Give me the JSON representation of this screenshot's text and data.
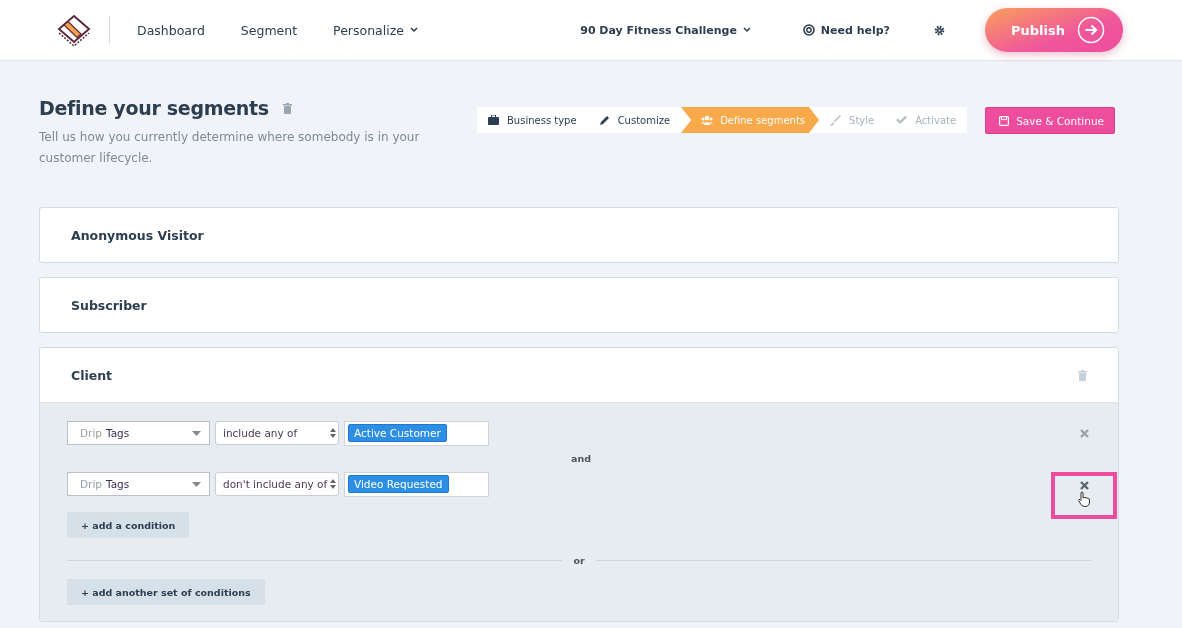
{
  "nav": {
    "links": [
      {
        "label": "Dashboard",
        "dropdown": false
      },
      {
        "label": "Segment",
        "dropdown": false
      },
      {
        "label": "Personalize",
        "dropdown": true
      }
    ],
    "project": "90 Day Fitness Challenge",
    "help": "Need help?",
    "publish": "Publish"
  },
  "header": {
    "title": "Define your segments",
    "description": "Tell us how you currently determine where somebody is in your customer lifecycle."
  },
  "steps": [
    {
      "label": "Business type",
      "selected": false,
      "disabled": false
    },
    {
      "label": "Customize",
      "selected": false,
      "disabled": false
    },
    {
      "label": "Define segments",
      "selected": true,
      "disabled": false
    },
    {
      "label": "Style",
      "selected": false,
      "disabled": true
    },
    {
      "label": "Activate",
      "selected": false,
      "disabled": true
    }
  ],
  "save_button": "Save & Continue",
  "segments": [
    {
      "name": "Anonymous Visitor",
      "expanded": false
    },
    {
      "name": "Subscriber",
      "expanded": false
    },
    {
      "name": "Client",
      "expanded": true,
      "conditions": [
        {
          "source": "Drip",
          "field": "Tags",
          "operator": "include any of",
          "tags": [
            "Active Customer"
          ],
          "highlighted": false
        },
        {
          "source": "Drip",
          "field": "Tags",
          "operator": "don't include any of",
          "tags": [
            "Video Requested"
          ],
          "highlighted": true
        }
      ],
      "joiner": "and",
      "add_condition": "+ add a condition",
      "separator": "or",
      "add_set": "+ add another set of conditions"
    }
  ]
}
